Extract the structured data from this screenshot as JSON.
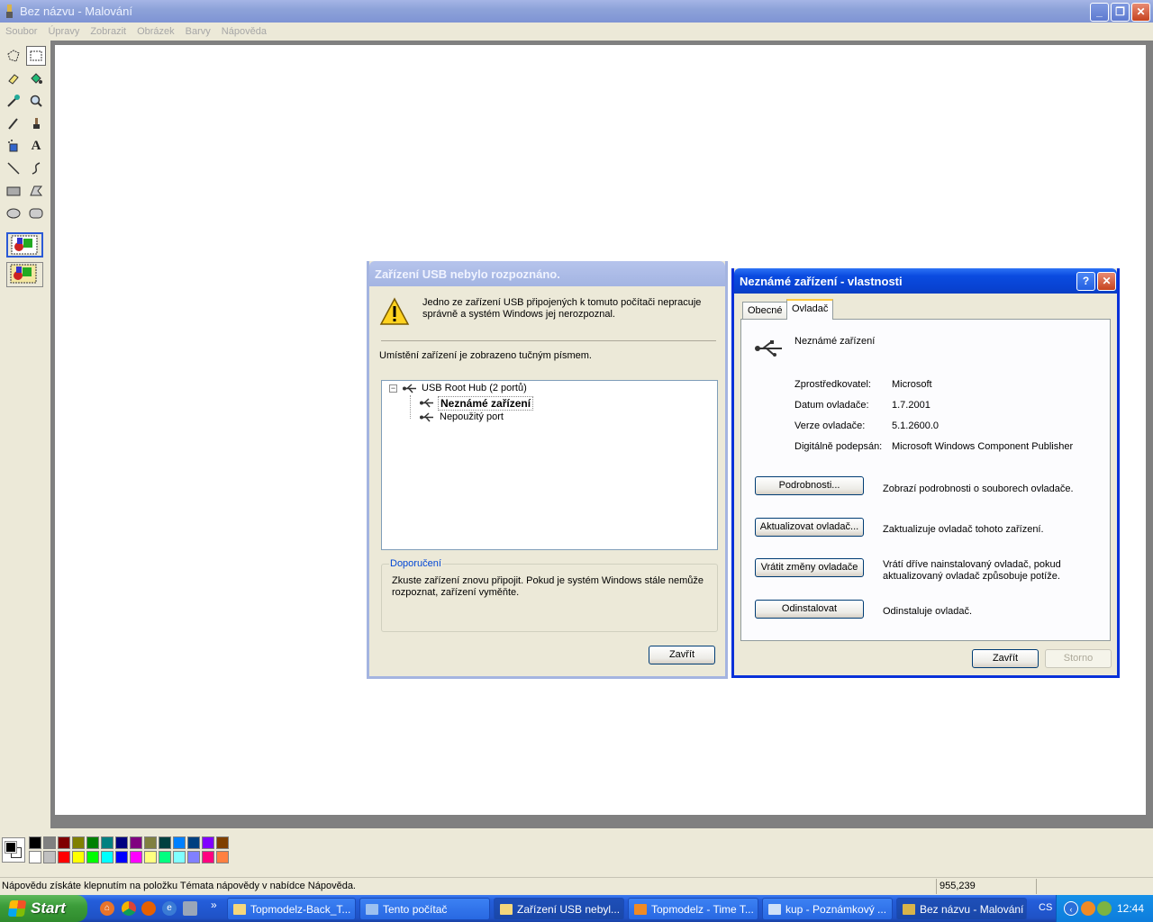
{
  "paint": {
    "title": "Bez názvu - Malování",
    "menu": [
      "Soubor",
      "Úpravy",
      "Zobrazit",
      "Obrázek",
      "Barvy",
      "Nápověda"
    ],
    "status_text": "Nápovědu získáte klepnutím na položku Témata nápovědy v nabídce Nápověda.",
    "coords": "955,239",
    "palette_top": [
      "#000000",
      "#808080",
      "#800000",
      "#808000",
      "#008000",
      "#008080",
      "#000080",
      "#800080",
      "#808040",
      "#004040",
      "#0080ff",
      "#004080",
      "#8000ff",
      "#804000"
    ],
    "palette_bottom": [
      "#ffffff",
      "#c0c0c0",
      "#ff0000",
      "#ffff00",
      "#00ff00",
      "#00ffff",
      "#0000ff",
      "#ff00ff",
      "#ffff80",
      "#00ff80",
      "#80ffff",
      "#8080ff",
      "#ff0080",
      "#ff8040"
    ]
  },
  "usb_dialog": {
    "title": "Zařízení USB nebylo rozpoznáno.",
    "message_line1": "Jedno ze zařízení USB připojených k tomuto počítači nepracuje",
    "message_line2": "správně a systém Windows jej nerozpoznal.",
    "location_text": "Umístění zařízení je zobrazeno tučným písmem.",
    "tree_root": "USB Root Hub (2 portů)",
    "tree_child1": "Neznámé zařízení",
    "tree_child2": "Nepoužitý port",
    "recommend_title": "Doporučení",
    "recommend_line1": "Zkuste zařízení znovu připojit. Pokud je systém Windows stále nemůže",
    "recommend_line2": "rozpoznat, zařízení vyměňte.",
    "close_label": "Zavřít"
  },
  "props_dialog": {
    "title": "Neznámé zařízení - vlastnosti",
    "help_label": "?",
    "tabs": [
      "Obecné",
      "Ovladač"
    ],
    "device_name": "Neznámé zařízení",
    "fields": [
      {
        "label": "Zprostředkovatel:",
        "value": "Microsoft"
      },
      {
        "label": "Datum ovladače:",
        "value": "1.7.2001"
      },
      {
        "label": "Verze ovladače:",
        "value": "5.1.2600.0"
      },
      {
        "label": "Digitálně podepsán:",
        "value": "Microsoft Windows Component Publisher"
      }
    ],
    "actions": [
      {
        "button": "Podrobnosti...",
        "desc1": "Zobrazí podrobnosti o souborech ovladače.",
        "desc2": ""
      },
      {
        "button": "Aktualizovat ovladač...",
        "desc1": "Zaktualizuje ovladač tohoto zařízení.",
        "desc2": ""
      },
      {
        "button": "Vrátit změny ovladače",
        "desc1": "Vrátí dříve nainstalovaný ovladač, pokud",
        "desc2": "aktualizovaný ovladač způsobuje potíže."
      },
      {
        "button": "Odinstalovat",
        "desc1": "Odinstaluje ovladač.",
        "desc2": ""
      }
    ],
    "ok_label": "Zavřít",
    "cancel_label": "Storno"
  },
  "taskbar": {
    "start": "Start",
    "chevron": "»",
    "tasks": [
      "Topmodelz-Back_T...",
      "Tento počítač",
      "Zařízení USB nebyl...",
      "Topmodelz - Time T...",
      "kup - Poznámkový ...",
      "Bez názvu - Malování"
    ],
    "lang": "CS",
    "clock": "12:44"
  }
}
